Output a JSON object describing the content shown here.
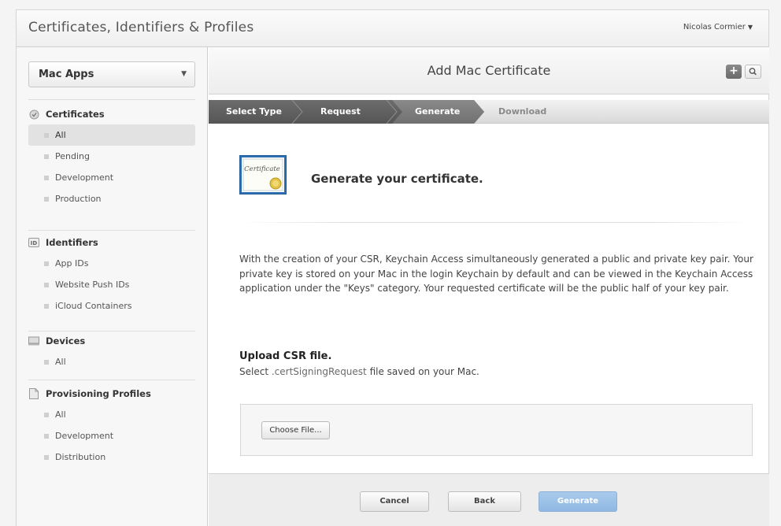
{
  "header": {
    "app_title": "Certificates, Identifiers & Profiles",
    "user_name": "Nicolas Cormier"
  },
  "sidebar": {
    "platform": "Mac Apps",
    "sections": {
      "certificates": {
        "title": "Certificates",
        "items": [
          "All",
          "Pending",
          "Development",
          "Production"
        ],
        "selected": "All"
      },
      "identifiers": {
        "title": "Identifiers",
        "icon_text": "ID",
        "items": [
          "App IDs",
          "Website Push IDs",
          "iCloud Containers"
        ]
      },
      "devices": {
        "title": "Devices",
        "items": [
          "All"
        ]
      },
      "profiles": {
        "title": "Provisioning Profiles",
        "items": [
          "All",
          "Development",
          "Distribution"
        ]
      }
    }
  },
  "main": {
    "title": "Add Mac Certificate",
    "steps": [
      "Select Type",
      "Request",
      "Generate",
      "Download"
    ],
    "active_step": "Generate",
    "cert_icon_text": "Certificate",
    "heading": "Generate your certificate.",
    "description": "With the creation of your CSR, Keychain Access simultaneously generated a public and private key pair. Your private key is stored on your Mac in the login Keychain by default and can be viewed in the Keychain Access application under the \"Keys\" category. Your requested certificate will be the public half of your key pair.",
    "upload": {
      "title": "Upload CSR file.",
      "desc_prefix": "Select ",
      "desc_ext": ".certSigningRequest",
      "desc_suffix": " file saved on your Mac.",
      "choose_label": "Choose File..."
    },
    "footer": {
      "cancel": "Cancel",
      "back": "Back",
      "generate": "Generate"
    }
  },
  "colors": {
    "step_done": "#5f5f5f",
    "step_active": "#7a7a7a",
    "generate_button": "#9ec2e8"
  }
}
